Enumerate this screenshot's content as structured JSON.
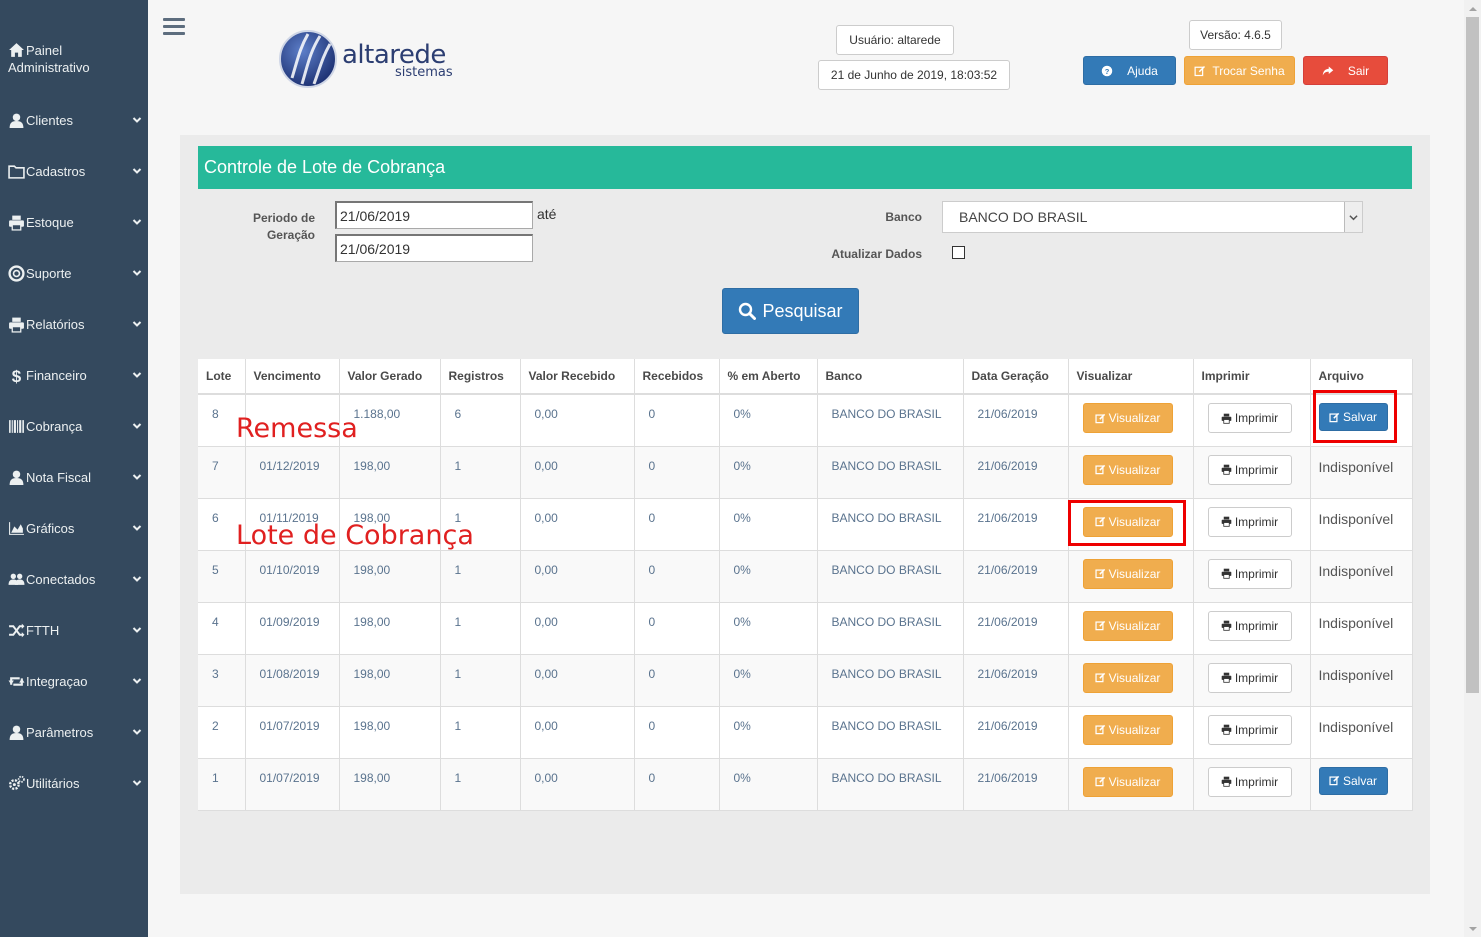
{
  "sidebar": {
    "top_label_1": "Painel",
    "top_label_2": "Administrativo",
    "items": [
      {
        "label": "Clientes",
        "icon": "user-icon"
      },
      {
        "label": "Cadastros",
        "icon": "folder-icon"
      },
      {
        "label": "Estoque",
        "icon": "print-icon"
      },
      {
        "label": "Suporte",
        "icon": "lifebuoy-icon"
      },
      {
        "label": "Relatórios",
        "icon": "print-icon"
      },
      {
        "label": "Financeiro",
        "icon": "dollar-icon"
      },
      {
        "label": "Cobrança",
        "icon": "barcode-icon"
      },
      {
        "label": "Nota Fiscal",
        "icon": "user-icon"
      },
      {
        "label": "Gráficos",
        "icon": "area-chart-icon"
      },
      {
        "label": "Conectados",
        "icon": "users-icon"
      },
      {
        "label": "FTTH",
        "icon": "random-icon"
      },
      {
        "label": "Integraçao",
        "icon": "retweet-icon"
      },
      {
        "label": "Parâmetros",
        "icon": "user-icon"
      },
      {
        "label": "Utilitários",
        "icon": "cogs-icon"
      }
    ]
  },
  "header": {
    "logo_main": "altarede",
    "logo_sub": "sistemas",
    "user": "Usuário: altarede",
    "datetime": "21 de Junho de 2019, 18:03:52",
    "version": "Versão: 4.6.5",
    "help_label": "Ajuda",
    "change_password_label": "Trocar Senha",
    "logout_label": "Sair"
  },
  "panel": {
    "title": "Controle de Lote de Cobrança",
    "period_label_1": "Periodo de",
    "period_label_2": "Geração",
    "date_from": "21/06/2019",
    "date_to": "21/06/2019",
    "until_label": "até",
    "bank_label": "Banco",
    "bank_value": "BANCO DO BRASIL",
    "update_label": "Atualizar Dados",
    "search_label": "Pesquisar"
  },
  "table": {
    "headers": [
      "Lote",
      "Vencimento",
      "Valor Gerado",
      "Registros",
      "Valor Recebido",
      "Recebidos",
      "% em Aberto",
      "Banco",
      "Data Geração",
      "Visualizar",
      "Imprimir",
      "Arquivo"
    ],
    "view_label": "Visualizar",
    "print_label": "Imprimir",
    "save_label": "Salvar",
    "unavailable_label": "Indisponível",
    "rows": [
      {
        "lote": "8",
        "venc": "",
        "valor": "1.188,00",
        "reg": "6",
        "receb_valor": "0,00",
        "receb": "0",
        "aberto": "0%",
        "banco": "BANCO DO BRASIL",
        "data": "21/06/2019",
        "arquivo": "save"
      },
      {
        "lote": "7",
        "venc": "01/12/2019",
        "valor": "198,00",
        "reg": "1",
        "receb_valor": "0,00",
        "receb": "0",
        "aberto": "0%",
        "banco": "BANCO DO BRASIL",
        "data": "21/06/2019",
        "arquivo": "unavailable"
      },
      {
        "lote": "6",
        "venc": "01/11/2019",
        "valor": "198,00",
        "reg": "1",
        "receb_valor": "0,00",
        "receb": "0",
        "aberto": "0%",
        "banco": "BANCO DO BRASIL",
        "data": "21/06/2019",
        "arquivo": "unavailable"
      },
      {
        "lote": "5",
        "venc": "01/10/2019",
        "valor": "198,00",
        "reg": "1",
        "receb_valor": "0,00",
        "receb": "0",
        "aberto": "0%",
        "banco": "BANCO DO BRASIL",
        "data": "21/06/2019",
        "arquivo": "unavailable"
      },
      {
        "lote": "4",
        "venc": "01/09/2019",
        "valor": "198,00",
        "reg": "1",
        "receb_valor": "0,00",
        "receb": "0",
        "aberto": "0%",
        "banco": "BANCO DO BRASIL",
        "data": "21/06/2019",
        "arquivo": "unavailable"
      },
      {
        "lote": "3",
        "venc": "01/08/2019",
        "valor": "198,00",
        "reg": "1",
        "receb_valor": "0,00",
        "receb": "0",
        "aberto": "0%",
        "banco": "BANCO DO BRASIL",
        "data": "21/06/2019",
        "arquivo": "unavailable"
      },
      {
        "lote": "2",
        "venc": "01/07/2019",
        "valor": "198,00",
        "reg": "1",
        "receb_valor": "0,00",
        "receb": "0",
        "aberto": "0%",
        "banco": "BANCO DO BRASIL",
        "data": "21/06/2019",
        "arquivo": "unavailable"
      },
      {
        "lote": "1",
        "venc": "01/07/2019",
        "valor": "198,00",
        "reg": "1",
        "receb_valor": "0,00",
        "receb": "0",
        "aberto": "0%",
        "banco": "BANCO DO BRASIL",
        "data": "21/06/2019",
        "arquivo": "save"
      }
    ]
  },
  "annotations": {
    "remessa": "Remessa",
    "lote_cobranca": "Lote de Cobrança"
  },
  "colors": {
    "sidebar": "#34495e",
    "title_bar": "#26b99a",
    "primary": "#337ab7",
    "warning": "#f0ad4e",
    "danger": "#e74c3c",
    "annotation": "#e00000"
  }
}
